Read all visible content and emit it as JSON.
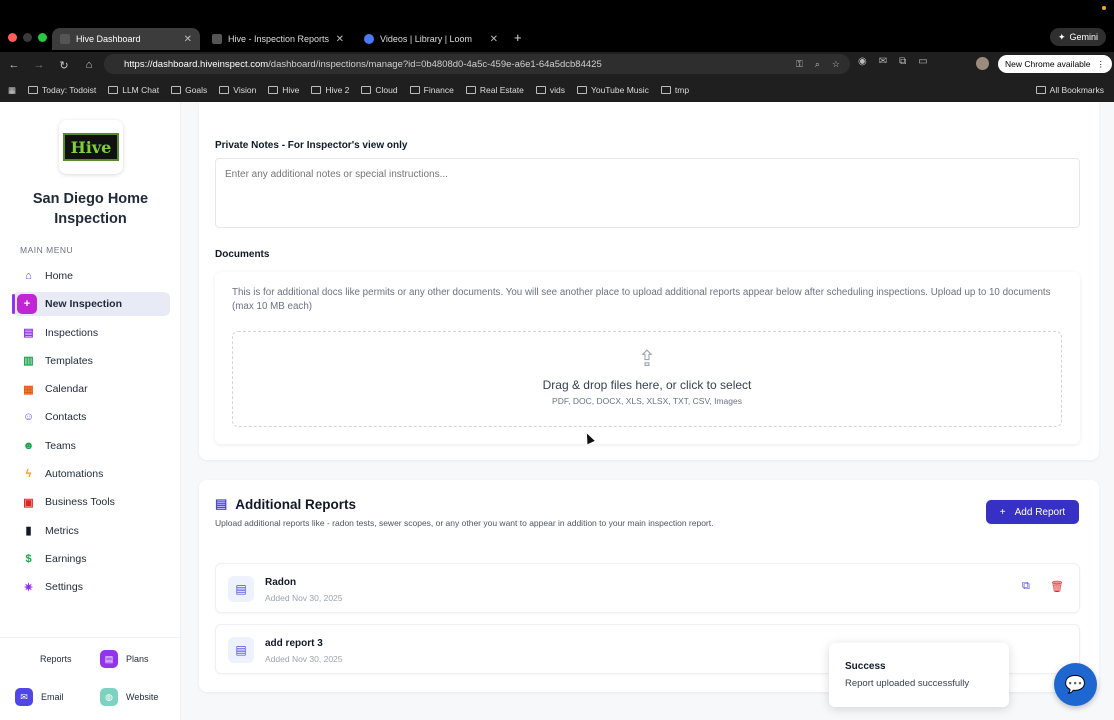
{
  "browser": {
    "tabs": [
      {
        "title": "Hive Dashboard",
        "active": true
      },
      {
        "title": "Hive - Inspection Reports",
        "active": false
      },
      {
        "title": "Videos | Library | Loom",
        "active": false
      }
    ],
    "gemini_label": "Gemini",
    "url_host": "https://dashboard.hiveinspect.com",
    "url_path": "/dashboard/inspections/manage?id=0b4808d0-4a5c-459e-a6e1-64a5dcb84425",
    "new_chrome_label": "New Chrome available",
    "bookmarks": [
      "Today: Todoist",
      "LLM Chat",
      "Goals",
      "Vision",
      "Hive",
      "Hive 2",
      "Cloud",
      "Finance",
      "Real Estate",
      "vids",
      "YouTube Music",
      "tmp"
    ],
    "all_bookmarks": "All Bookmarks"
  },
  "sidebar": {
    "company": "San Diego Home Inspection",
    "logo_text": "Hive",
    "main_menu_label": "MAIN MENU",
    "items": [
      {
        "label": "Home",
        "icon": "home-icon",
        "color": "#4f46e5",
        "glyph": "⌂"
      },
      {
        "label": "New Inspection",
        "icon": "plus-icon",
        "color": "#c026d3",
        "glyph": "+",
        "active": true
      },
      {
        "label": "Inspections",
        "icon": "clipboard-icon",
        "color": "#9333ea",
        "glyph": "▤"
      },
      {
        "label": "Templates",
        "icon": "document-icon",
        "color": "#16a34a",
        "glyph": "▥"
      },
      {
        "label": "Calendar",
        "icon": "calendar-icon",
        "color": "#ea580c",
        "glyph": "▦"
      },
      {
        "label": "Contacts",
        "icon": "users-icon",
        "color": "#4f46e5",
        "glyph": "☺"
      },
      {
        "label": "Teams",
        "icon": "team-icon",
        "color": "#16a34a",
        "glyph": "☻"
      },
      {
        "label": "Automations",
        "icon": "bolt-icon",
        "color": "#f59e0b",
        "glyph": "ϟ"
      },
      {
        "label": "Business Tools",
        "icon": "briefcase-icon",
        "color": "#dc2626",
        "glyph": "▣"
      },
      {
        "label": "Metrics",
        "icon": "chart-icon",
        "color": "#111827",
        "glyph": "▮"
      },
      {
        "label": "Earnings",
        "icon": "dollar-icon",
        "color": "#16a34a",
        "glyph": "$"
      },
      {
        "label": "Settings",
        "icon": "gear-icon",
        "color": "#9333ea",
        "glyph": "✷"
      }
    ],
    "bottom": {
      "reports": "Reports",
      "plans": "Plans",
      "email": "Email",
      "website": "Website"
    }
  },
  "form": {
    "private_notes_label": "Private Notes - For Inspector's view only",
    "private_notes_placeholder": "Enter any additional notes or special instructions...",
    "documents_label": "Documents",
    "documents_desc": "This is for additional docs like permits or any other documents. You will see another place to upload additional reports appear below after scheduling inspections. Upload up to 10 documents (max 10 MB each)",
    "drop_title": "Drag & drop files here, or click to select",
    "drop_types": "PDF, DOC, DOCX, XLS, XLSX, TXT, CSV, Images"
  },
  "additional_reports": {
    "title": "Additional Reports",
    "subtitle": "Upload additional reports like - radon tests, sewer scopes, or any other you want to appear in addition to your main inspection report.",
    "add_button": "Add Report",
    "reports": [
      {
        "name": "Radon",
        "date": "Added Nov 30, 2025"
      },
      {
        "name": "add report 3",
        "date": "Added Nov 30, 2025"
      }
    ]
  },
  "toast": {
    "title": "Success",
    "message": "Report uploaded successfully"
  }
}
